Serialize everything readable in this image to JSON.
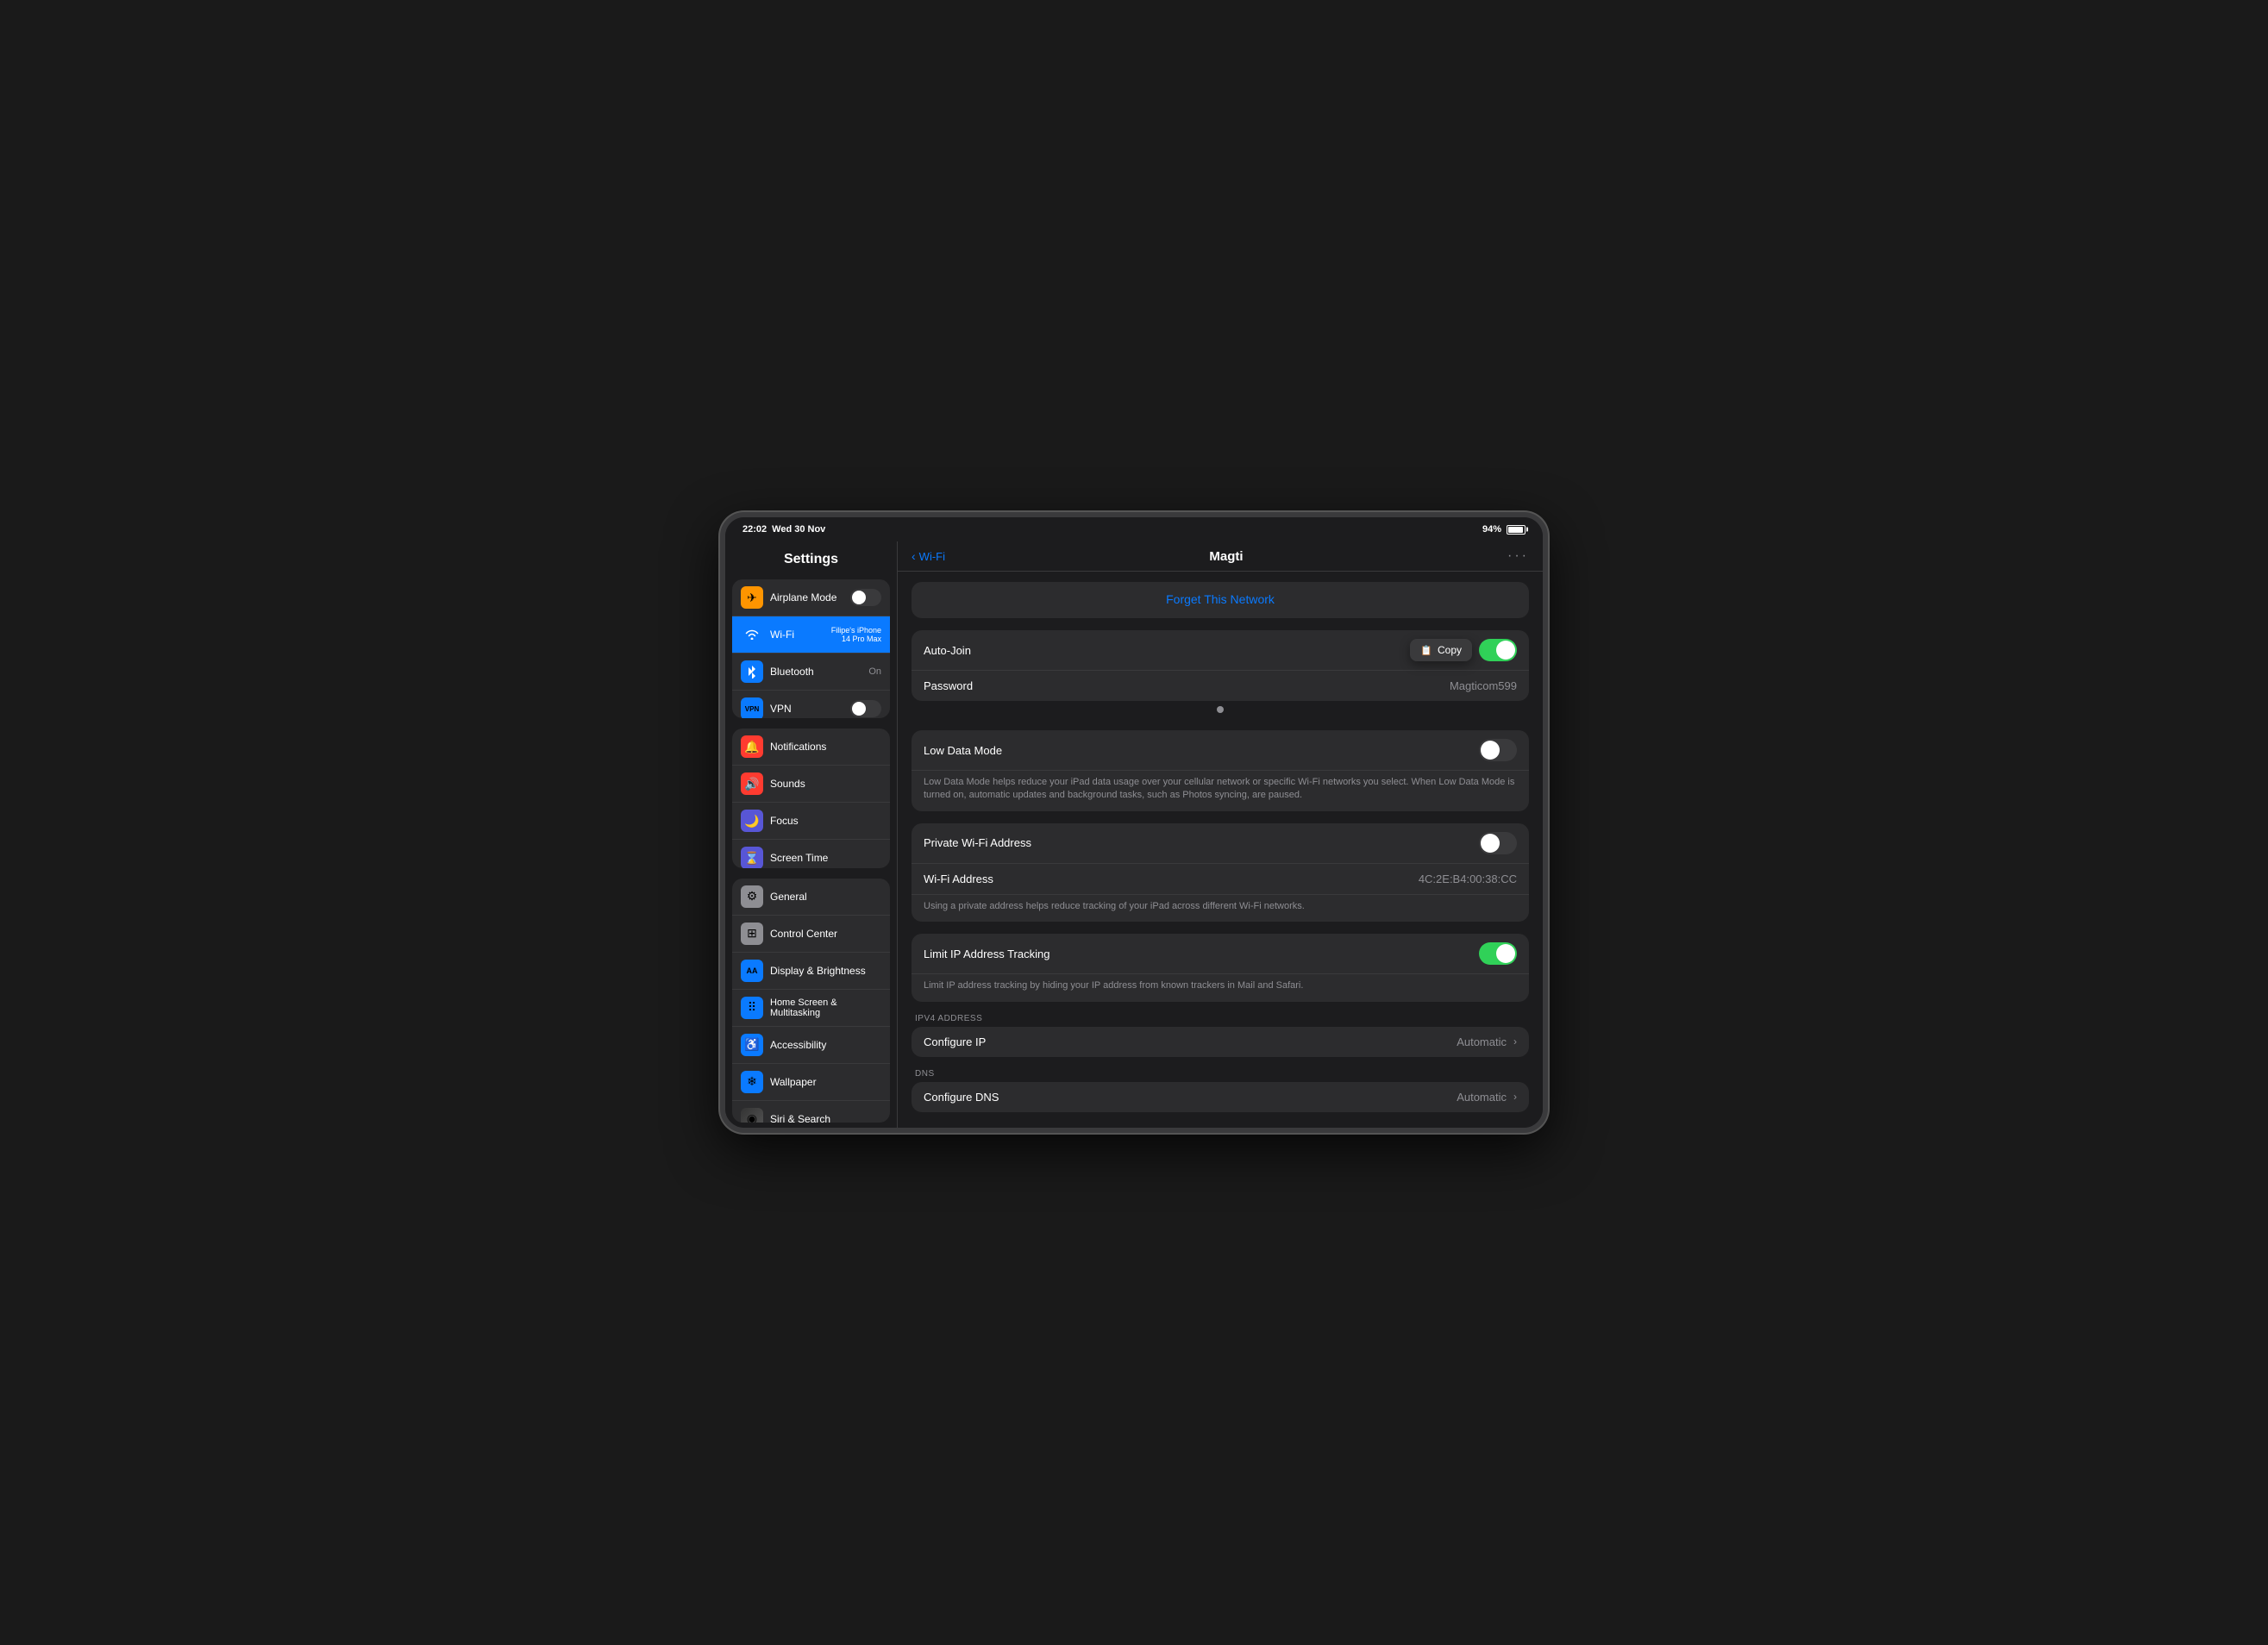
{
  "statusBar": {
    "time": "22:02",
    "date": "Wed 30 Nov",
    "battery": "94%",
    "batteryWidth": "94"
  },
  "sidebar": {
    "title": "Settings",
    "groups": [
      {
        "id": "connectivity",
        "items": [
          {
            "id": "airplane-mode",
            "label": "Airplane Mode",
            "icon": "✈",
            "iconBg": "#ff9500",
            "toggle": true,
            "toggleOn": false
          },
          {
            "id": "wifi",
            "label": "Wi-Fi",
            "value": "Filipe's iPhone 14 Pro Max",
            "iconBg": "#0a7aff",
            "active": true
          },
          {
            "id": "bluetooth",
            "label": "Bluetooth",
            "value": "On",
            "iconBg": "#0a7aff"
          },
          {
            "id": "vpn",
            "label": "VPN",
            "iconBg": "#0a7aff",
            "toggle": true,
            "toggleOn": false
          }
        ]
      },
      {
        "id": "system",
        "items": [
          {
            "id": "notifications",
            "label": "Notifications",
            "iconBg": "#ff3b30"
          },
          {
            "id": "sounds",
            "label": "Sounds",
            "iconBg": "#ff3b30"
          },
          {
            "id": "focus",
            "label": "Focus",
            "iconBg": "#5856d6"
          },
          {
            "id": "screen-time",
            "label": "Screen Time",
            "iconBg": "#5856d6"
          }
        ]
      },
      {
        "id": "preferences",
        "items": [
          {
            "id": "general",
            "label": "General",
            "iconBg": "#8e8e93"
          },
          {
            "id": "control-center",
            "label": "Control Center",
            "iconBg": "#8e8e93"
          },
          {
            "id": "display-brightness",
            "label": "Display & Brightness",
            "iconBg": "#0a7aff"
          },
          {
            "id": "home-screen",
            "label": "Home Screen & Multitasking",
            "iconBg": "#0a7aff"
          },
          {
            "id": "accessibility",
            "label": "Accessibility",
            "iconBg": "#0a7aff"
          },
          {
            "id": "wallpaper",
            "label": "Wallpaper",
            "iconBg": "#0a7aff"
          },
          {
            "id": "siri-search",
            "label": "Siri & Search",
            "iconBg": "#333"
          }
        ]
      }
    ]
  },
  "detail": {
    "backLabel": "Wi-Fi",
    "title": "Magti",
    "dots": "···",
    "forgetNetwork": "Forget This Network",
    "sections": [
      {
        "id": "auto-join-section",
        "rows": [
          {
            "id": "auto-join",
            "label": "Auto-Join",
            "toggle": true,
            "toggleOn": true
          },
          {
            "id": "password",
            "label": "Password",
            "value": "Magticom599"
          }
        ]
      },
      {
        "id": "low-data-section",
        "rows": [
          {
            "id": "low-data-mode",
            "label": "Low Data Mode",
            "toggle": true,
            "toggleOn": false
          }
        ],
        "description": "Low Data Mode helps reduce your iPad data usage over your cellular network or specific Wi-Fi networks you select. When Low Data Mode is turned on, automatic updates and background tasks, such as Photos syncing, are paused."
      },
      {
        "id": "privacy-section",
        "rows": [
          {
            "id": "private-wifi",
            "label": "Private Wi-Fi Address",
            "toggle": true,
            "toggleOn": false
          },
          {
            "id": "wifi-address",
            "label": "Wi-Fi Address",
            "value": "4C:2E:B4:00:38:CC"
          }
        ],
        "description": "Using a private address helps reduce tracking of your iPad across different Wi-Fi networks."
      },
      {
        "id": "tracking-section",
        "rows": [
          {
            "id": "limit-ip",
            "label": "Limit IP Address Tracking",
            "toggle": true,
            "toggleOn": true
          }
        ],
        "description": "Limit IP address tracking by hiding your IP address from known trackers in Mail and Safari."
      },
      {
        "id": "ipv4-section",
        "sectionLabel": "IPV4 ADDRESS",
        "rows": [
          {
            "id": "configure-ip",
            "label": "Configure IP",
            "value": "Automatic",
            "chevron": true
          }
        ]
      },
      {
        "id": "dns-section",
        "sectionLabel": "DNS",
        "rows": [
          {
            "id": "configure-dns",
            "label": "Configure DNS",
            "value": "Automatic",
            "chevron": true
          }
        ]
      }
    ],
    "copyPopup": {
      "icon": "📋",
      "label": "Copy"
    }
  },
  "icons": {
    "airplane": "✈",
    "wifi": "📶",
    "bluetooth": "𝔅",
    "vpn": "VPN",
    "notifications": "🔔",
    "sounds": "🔊",
    "focus": "🌙",
    "screentime": "⌛",
    "general": "⚙",
    "controlcenter": "☰",
    "display": "AA",
    "homescreen": "⊞",
    "accessibility": "♿",
    "wallpaper": "❄",
    "siri": "◉"
  }
}
